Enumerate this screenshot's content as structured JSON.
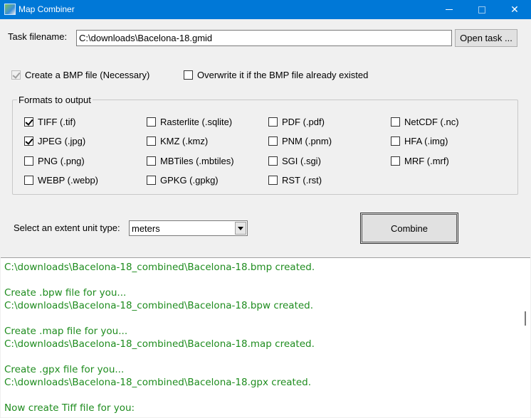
{
  "window": {
    "title": "Map Combiner"
  },
  "task": {
    "label": "Task filename:",
    "value": "C:\\downloads\\Bacelona-18.gmid",
    "open_button": "Open task ..."
  },
  "options": {
    "create_bmp": {
      "label": "Create a  BMP file (Necessary)",
      "checked": true,
      "disabled": true
    },
    "overwrite": {
      "label": "Overwrite it if the BMP file already existed",
      "checked": false
    }
  },
  "formats": {
    "legend": "Formats to output",
    "columns": [
      [
        {
          "label": "TIFF (.tif)",
          "checked": true
        },
        {
          "label": "JPEG (.jpg)",
          "checked": true
        },
        {
          "label": "PNG (.png)",
          "checked": false
        },
        {
          "label": "WEBP (.webp)",
          "checked": false
        }
      ],
      [
        {
          "label": "Rasterlite (.sqlite)",
          "checked": false
        },
        {
          "label": "KMZ (.kmz)",
          "checked": false
        },
        {
          "label": "MBTiles (.mbtiles)",
          "checked": false
        },
        {
          "label": "GPKG (.gpkg)",
          "checked": false
        }
      ],
      [
        {
          "label": "PDF (.pdf)",
          "checked": false
        },
        {
          "label": "PNM (.pnm)",
          "checked": false
        },
        {
          "label": "SGI (.sgi)",
          "checked": false
        },
        {
          "label": "RST (.rst)",
          "checked": false
        }
      ],
      [
        {
          "label": "NetCDF (.nc)",
          "checked": false
        },
        {
          "label": "HFA (.img)",
          "checked": false
        },
        {
          "label": "MRF (.mrf)",
          "checked": false
        }
      ]
    ]
  },
  "extent": {
    "label": "Select an extent unit type:",
    "value": "meters"
  },
  "combine_button": "Combine",
  "log": {
    "color": "#1e8c1e",
    "lines": [
      "C:\\downloads\\Bacelona-18_combined\\Bacelona-18.bmp created.",
      "",
      "Create .bpw file for you...",
      "C:\\downloads\\Bacelona-18_combined\\Bacelona-18.bpw created.",
      "",
      "Create .map file for you...",
      "C:\\downloads\\Bacelona-18_combined\\Bacelona-18.map created.",
      "",
      "Create .gpx file for you...",
      "C:\\downloads\\Bacelona-18_combined\\Bacelona-18.gpx created.",
      "",
      "Now create Tiff file for you:"
    ]
  }
}
